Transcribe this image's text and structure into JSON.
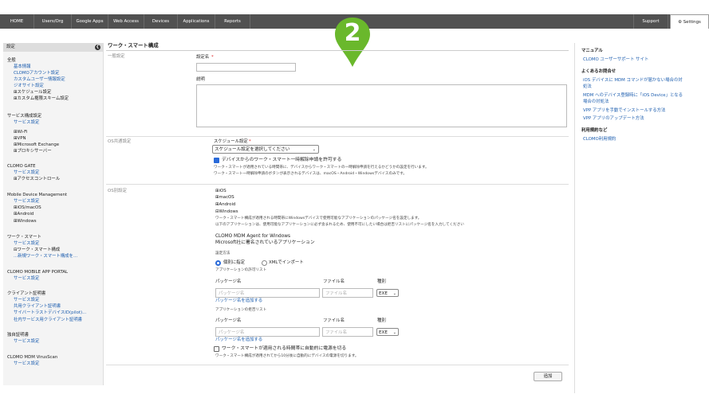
{
  "nav": {
    "items": [
      "HOME",
      "Users/Org",
      "Google Apps",
      "Web Access",
      "Devices",
      "Applications",
      "Reports"
    ],
    "support": "Support",
    "settings": "Settings"
  },
  "callout": {
    "number": "2",
    "color": "#6ab82c"
  },
  "sidebar": {
    "header": "設定",
    "groups": [
      {
        "title": "全般",
        "items": [
          {
            "label": "基本情報",
            "style": "l"
          },
          {
            "label": "CLOMOアカウント設定",
            "style": "l"
          },
          {
            "label": "カスタムユーザー情報設定",
            "style": "l"
          },
          {
            "label": "ジオサイト設定",
            "style": "l"
          },
          {
            "label": "⊞スケジュール設定",
            "style": "d"
          },
          {
            "label": "⊞カスタム権限スキーム設定",
            "style": "d"
          }
        ]
      },
      {
        "title": "サービス構成設定",
        "items": [
          {
            "label": "サービス設定",
            "style": "l"
          },
          {
            "label": "⊞Wi-Fi",
            "style": "d"
          },
          {
            "label": "⊞VPN",
            "style": "d"
          },
          {
            "label": "⊞Microsoft Exchange",
            "style": "d"
          },
          {
            "label": "⊞プロキシサーバー",
            "style": "d"
          }
        ]
      },
      {
        "title": "CLOMO GATE",
        "items": [
          {
            "label": "サービス設定",
            "style": "l"
          },
          {
            "label": "⊞アクセスコントロール",
            "style": "d"
          }
        ]
      },
      {
        "title": "Mobile Device Management",
        "items": [
          {
            "label": "サービス設定",
            "style": "l"
          },
          {
            "label": "⊞iOS/macOS",
            "style": "d"
          },
          {
            "label": "⊞Android",
            "style": "d"
          },
          {
            "label": "⊞Windows",
            "style": "d"
          }
        ]
      },
      {
        "title": "ワーク・スマート",
        "items": [
          {
            "label": "サービス設定",
            "style": "l"
          },
          {
            "label": "⊟ワーク・スマート構成",
            "style": "d"
          },
          {
            "label": "...新規ワーク・スマート構成を...",
            "style": "l"
          }
        ]
      },
      {
        "title": "CLOMO MOBILE APP PORTAL",
        "items": [
          {
            "label": "サービス設定",
            "style": "l"
          }
        ]
      },
      {
        "title": "クライアント証明書",
        "items": [
          {
            "label": "サービス設定",
            "style": "l"
          },
          {
            "label": "共用クライアント証明書",
            "style": "l"
          },
          {
            "label": "サイバートラストデバイスID(pilot)...",
            "style": "l"
          },
          {
            "label": "社内サービス用クライアント証明書",
            "style": "l"
          }
        ]
      },
      {
        "title": "独自証明書",
        "items": [
          {
            "label": "サービス設定",
            "style": "l"
          }
        ]
      },
      {
        "title": "CLOMO MDM VirusScan",
        "items": [
          {
            "label": "サービス設定",
            "style": "l"
          }
        ]
      }
    ]
  },
  "main": {
    "title": "ワーク・スマート構成",
    "general_label": "一般設定",
    "name_label": "設定名",
    "required_mark": "*",
    "desc_label": "説明",
    "os_common_label": "OS共通設定",
    "schedule_label": "スケジュール設定",
    "schedule_select": "スケジュール設定を選択してください",
    "allow_temp_label": "デバイスからのワーク・スマート一時解除申請を許可する",
    "allow_temp_note1": "ワーク・スマートが適用されている時間帯に、デバイスからワーク・スマートの一時解除申請を行えるかどうかの設定を行います。",
    "allow_temp_note2": "ワーク・スマート一時解除申請のボタンが表示されるデバイスは、macOS・Android・Windowsデバイスのみです。",
    "os_specific_label": "OS別設定",
    "os_list": [
      "⊞iOS",
      "⊞macOS",
      "⊞Android",
      "⊟Windows"
    ],
    "win_note1": "ワーク・スマート構成が適用される時間帯にWindowsデバイスで使用可能なアプリケーションのパッケージ名を設定します。",
    "win_note2": "以下のアプリケーションは、使用可能なアプリケーションに必ず含まれるため、使用不可にしたい場合は拒否リストにパッケージ名を入力してください",
    "agent_line1": "CLOMO MDM Agent for Windows",
    "agent_line2": "Microsoft社に署名されているアプリケーション",
    "method_label": "設定方法",
    "radio_individual": "個別に指定",
    "radio_xml": "XMLでインポート",
    "allow_list_label": "アプリケーションの許可リスト",
    "col_package": "パッケージ名",
    "col_file": "ファイル名",
    "col_type": "種別",
    "package_placeholder": "パッケージ名",
    "file_placeholder": "ファイル名",
    "type_value": "EXE",
    "add_package": "パッケージ名を追加する",
    "deny_list_label": "アプリケーションの拒否リスト",
    "auto_power_label": "ワーク・スマートが適用される時間帯に自動的に電源を切る",
    "auto_power_note": "ワーク・スマート構成が適用されてから10分後に自動的にデバイスの電源を切ります。",
    "add_button": "追加"
  },
  "right": {
    "manual_title": "マニュアル",
    "manual_link": "CLOMO ユーザーサポート サイト",
    "faq_title": "よくあるお問合せ",
    "faq_links": [
      "iOS デバイスに MDM コマンドが届かない場合の対",
      "処法",
      "MDM へのデバイス登録時に「iOS Device」となる",
      "場合の対処法",
      "VPP アプリを手動でインストールする方法",
      "VPP アプリのアップデート方法"
    ],
    "terms_title": "利用規約など",
    "terms_link": "CLOMO利用規約"
  }
}
